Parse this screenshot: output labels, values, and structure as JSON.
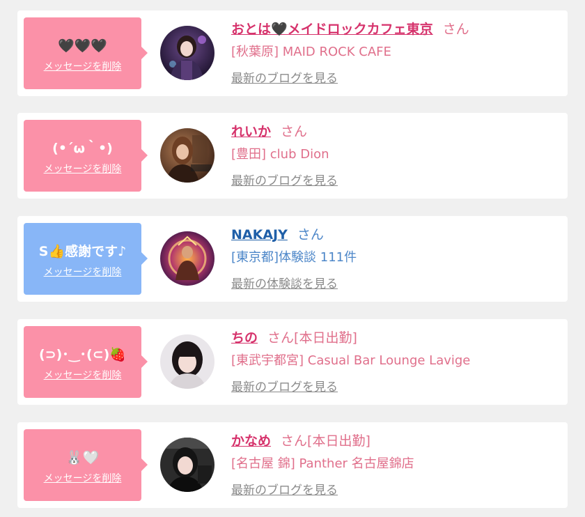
{
  "items": [
    {
      "message": "🖤🖤🖤",
      "delete_label": "メッセージを削除",
      "name": "おとは🖤メイドロックカフェ東京",
      "suffix": "さん",
      "status": "",
      "shop": "[秋葉原] MAID ROCK CAFE",
      "link": "最新のブログを見る",
      "theme": "pink"
    },
    {
      "message": "(•´ω｀•)",
      "delete_label": "メッセージを削除",
      "name": "れいか",
      "suffix": "さん",
      "status": "",
      "shop": "[豊田] club Dion",
      "link": "最新のブログを見る",
      "theme": "pink"
    },
    {
      "message": "S👍感謝です♪",
      "delete_label": "メッセージを削除",
      "name": "NAKAJY",
      "suffix": "さん",
      "status": "",
      "shop": "[東京都]体験談 111件",
      "link": "最新の体験談を見る",
      "theme": "blue"
    },
    {
      "message": "(⊃)･‿･(⊂)🍓",
      "delete_label": "メッセージを削除",
      "name": "ちの",
      "suffix": "さん",
      "status": "[本日出勤]",
      "shop": "[東武宇都宮] Casual Bar Lounge Lavige",
      "link": "最新のブログを見る",
      "theme": "pink"
    },
    {
      "message": "🐰🤍",
      "delete_label": "メッセージを削除",
      "name": "かなめ",
      "suffix": "さん",
      "status": "[本日出勤]",
      "shop": "[名古屋 錦] Panther 名古屋錦店",
      "link": "最新のブログを見る",
      "theme": "pink"
    }
  ]
}
